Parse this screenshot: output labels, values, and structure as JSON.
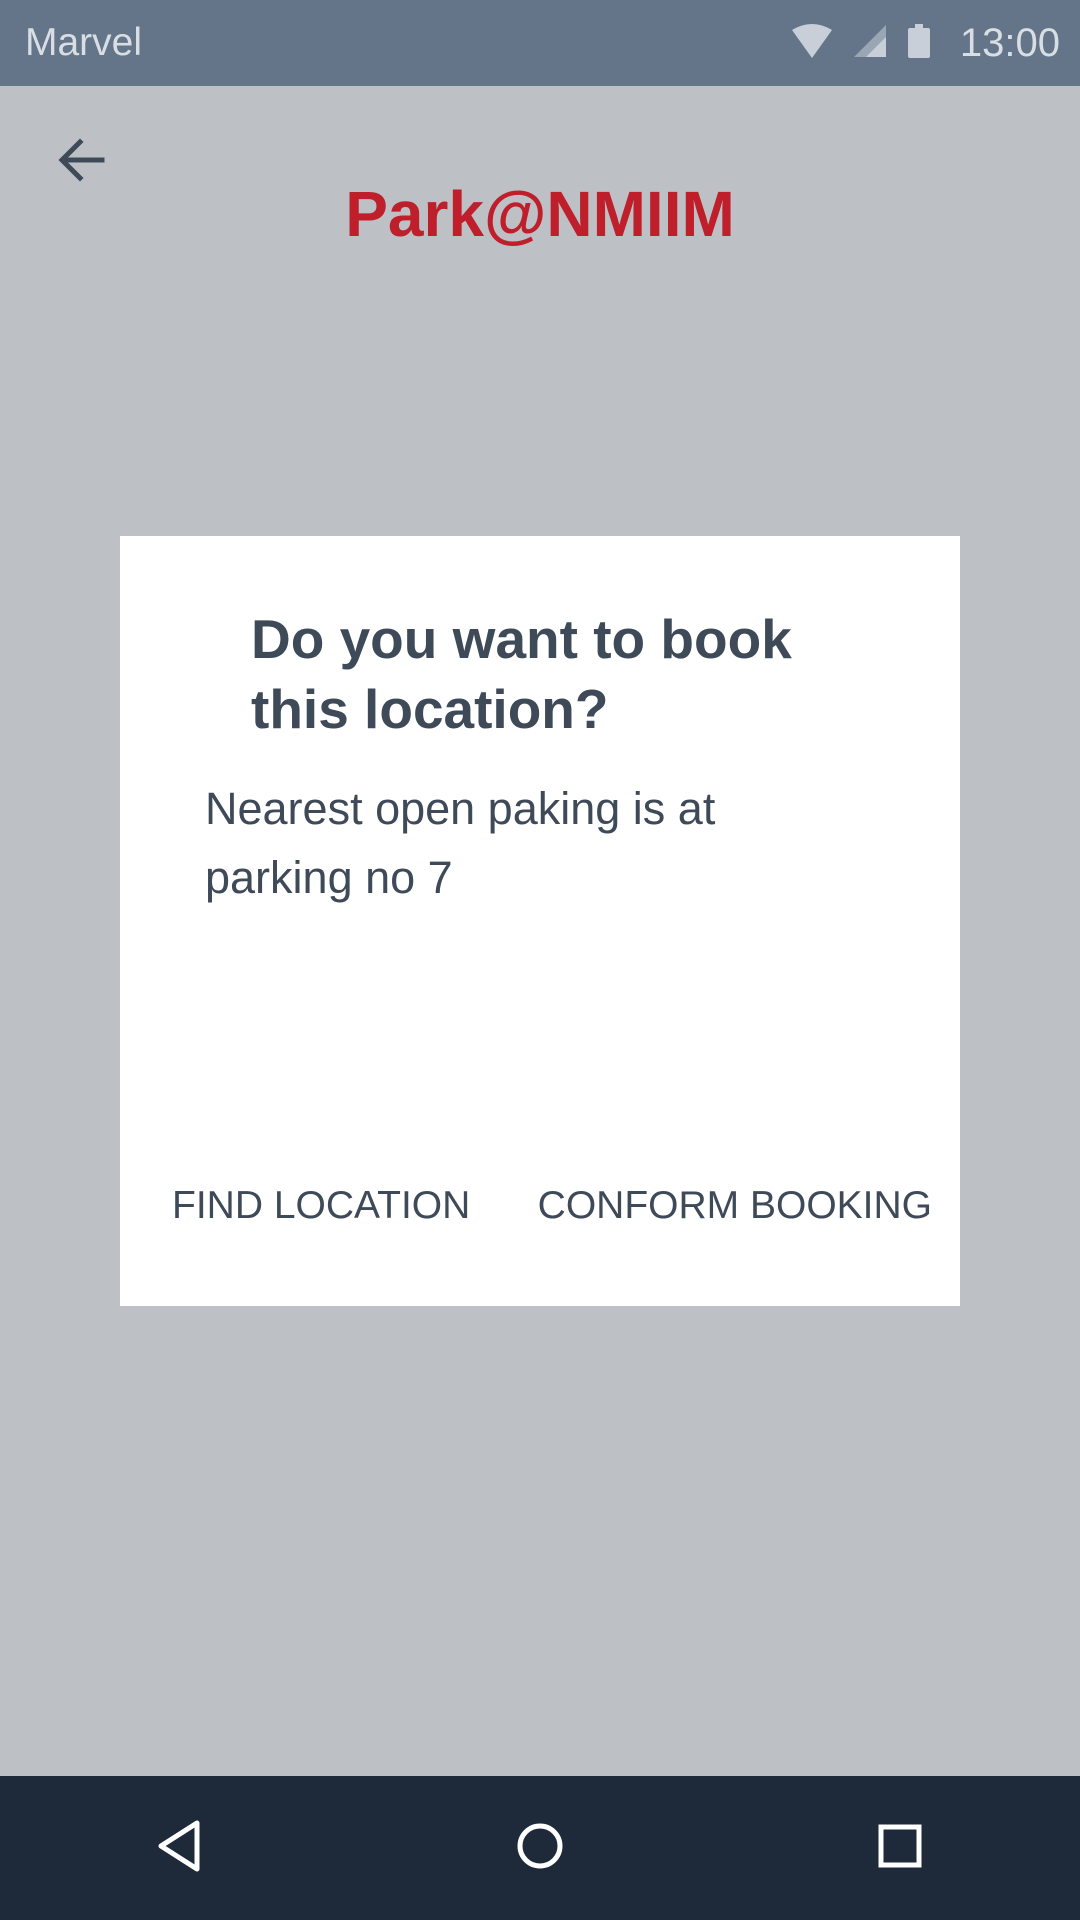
{
  "status_bar": {
    "app_name": "Marvel",
    "time": "13:00",
    "icons": [
      "wifi-icon",
      "cell-signal-icon",
      "battery-icon"
    ]
  },
  "header": {
    "back_icon": "arrow-left-icon",
    "title": "Park@NMIIM"
  },
  "dialog": {
    "title": "Do you want to book this location?",
    "message": "Nearest open paking is at parking no 7",
    "actions": {
      "find_location": "FIND LOCATION",
      "confirm_booking": "CONFORM BOOKING"
    }
  },
  "navigation_bar": {
    "icons": [
      "back-triangle-icon",
      "home-circle-icon",
      "recents-square-icon"
    ]
  },
  "colors": {
    "status_bar": "#647589",
    "screen_overlay": "#bdc1c5",
    "brand_red": "#be1f2b",
    "dialog_text": "#3f4a59",
    "navigation_bar": "#1e2a3a"
  }
}
